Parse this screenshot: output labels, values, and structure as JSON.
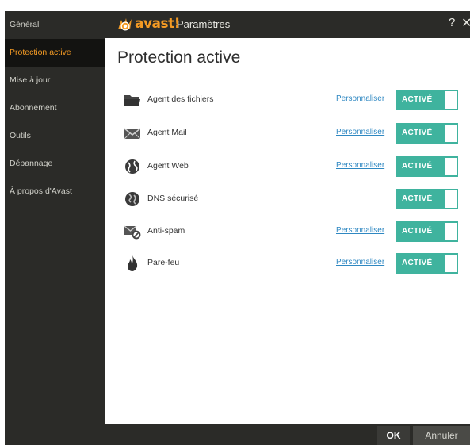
{
  "sidebar": {
    "items": [
      {
        "label": "Général",
        "active": false
      },
      {
        "label": "Protection active",
        "active": true
      },
      {
        "label": "Mise à jour",
        "active": false
      },
      {
        "label": "Abonnement",
        "active": false
      },
      {
        "label": "Outils",
        "active": false
      },
      {
        "label": "Dépannage",
        "active": false
      },
      {
        "label": "À propos d'Avast",
        "active": false
      }
    ]
  },
  "titlebar": {
    "brand": "avast",
    "brand_excl": "!",
    "title": "Paramètres",
    "help": "?",
    "close": "✕"
  },
  "main": {
    "title": "Protection active",
    "shields": [
      {
        "icon": "folder-icon",
        "label": "Agent des fichiers",
        "link": "Personnaliser",
        "status": "ACTIVÉ"
      },
      {
        "icon": "mail-icon",
        "label": "Agent Mail",
        "link": "Personnaliser",
        "status": "ACTIVÉ"
      },
      {
        "icon": "web-globe-icon",
        "label": "Agent Web",
        "link": "Personnaliser",
        "status": "ACTIVÉ"
      },
      {
        "icon": "dns-globe-icon",
        "label": "DNS sécurisé",
        "link": "",
        "status": "ACTIVÉ"
      },
      {
        "icon": "antispam-icon",
        "label": "Anti-spam",
        "link": "Personnaliser",
        "status": "ACTIVÉ"
      },
      {
        "icon": "flame-icon",
        "label": "Pare-feu",
        "link": "Personnaliser",
        "status": "ACTIVÉ"
      }
    ]
  },
  "footer": {
    "ok": "OK",
    "cancel": "Annuler"
  },
  "colors": {
    "accent": "#f39a24",
    "toggle_on": "#3fb39e",
    "link": "#2f88c2",
    "chrome": "#2b2b28"
  }
}
